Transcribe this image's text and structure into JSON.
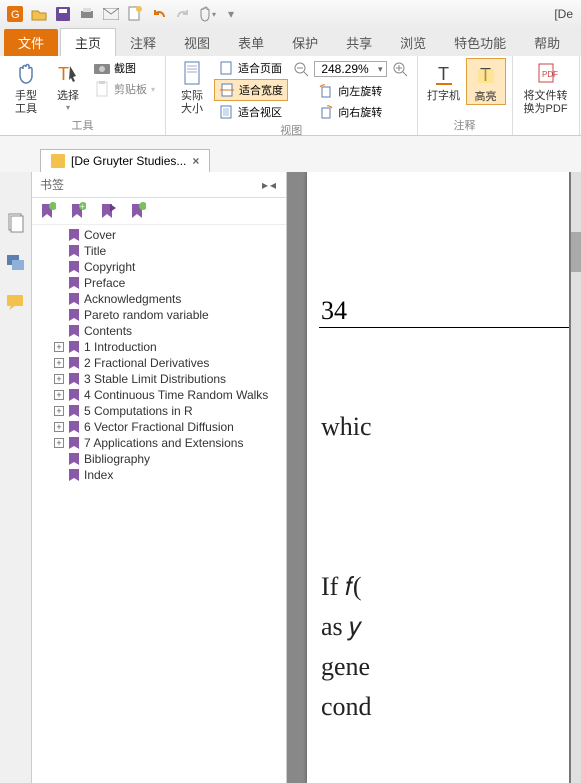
{
  "titlebar": {
    "app_hint": "[De"
  },
  "tabs": {
    "file": "文件",
    "items": [
      "主页",
      "注释",
      "视图",
      "表单",
      "保护",
      "共享",
      "浏览",
      "特色功能",
      "帮助"
    ],
    "active": 0
  },
  "ribbon": {
    "hand": "手型\n工具",
    "select": "选择",
    "tools_group": "工具",
    "snapshot": "截图",
    "clipboard": "剪贴板",
    "actual_size": "实际\n大小",
    "fit_page": "适合页面",
    "fit_width": "适合宽度",
    "fit_visible": "适合视区",
    "rotate_left": "向左旋转",
    "rotate_right": "向右旋转",
    "view_group": "视图",
    "zoom_value": "248.29%",
    "typewriter": "打字机",
    "highlight": "高亮",
    "annot_group": "注释",
    "convert": "将文件转\n换为PDF"
  },
  "doctab": {
    "label": "[De Gruyter Studies..."
  },
  "bookmarks": {
    "panel_title": "书签",
    "items": [
      {
        "label": "Cover",
        "exp": false
      },
      {
        "label": "Title",
        "exp": false
      },
      {
        "label": "Copyright",
        "exp": false
      },
      {
        "label": "Preface",
        "exp": false
      },
      {
        "label": "Acknowledgments",
        "exp": false
      },
      {
        "label": "Pareto random variable",
        "exp": false
      },
      {
        "label": "Contents",
        "exp": false
      },
      {
        "label": "1 Introduction",
        "exp": true
      },
      {
        "label": "2 Fractional Derivatives",
        "exp": true
      },
      {
        "label": "3 Stable Limit Distributions",
        "exp": true
      },
      {
        "label": "4 Continuous Time Random Walks",
        "exp": true
      },
      {
        "label": "5 Computations in R",
        "exp": true
      },
      {
        "label": "6 Vector Fractional Diffusion",
        "exp": true
      },
      {
        "label": "7 Applications and Extensions",
        "exp": true
      },
      {
        "label": "Bibliography",
        "exp": false
      },
      {
        "label": "Index",
        "exp": false
      }
    ]
  },
  "page": {
    "num": "34",
    "line1": "whic",
    "line2": "If 𝑓(",
    "line3": "as 𝑦",
    "line4": "gene",
    "line5": "cond"
  }
}
